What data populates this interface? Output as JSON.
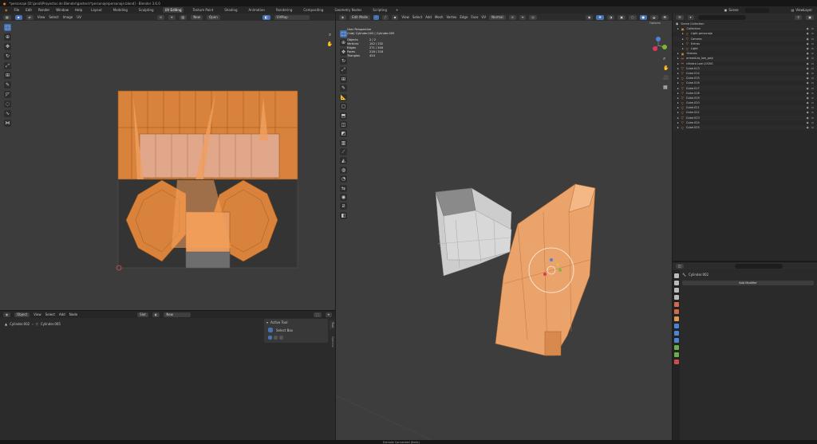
{
  "window": {
    "title": "*personaje [D:\\jandi\\Proyectos de Blender\\gasters\\*personaje\\personaje.blend] - Blender 3.6.0"
  },
  "menubar": {
    "menus": [
      "File",
      "Edit",
      "Render",
      "Window",
      "Help"
    ],
    "workspaces": [
      "Layout",
      "Modeling",
      "Sculpting",
      "UV Editing",
      "Texture Paint",
      "Shading",
      "Animation",
      "Rendering",
      "Compositing",
      "Geometry Nodes",
      "Scripting"
    ],
    "active_workspace": "UV Editing",
    "scene_label": "Scene",
    "viewlayer_label": "ViewLayer"
  },
  "uv_editor": {
    "header_menus": [
      "View",
      "Select",
      "Image",
      "UV"
    ],
    "new_label": "New",
    "open_label": "Open",
    "uvmap_label": "UVMap"
  },
  "lower_left": {
    "mode": "Object",
    "menus": [
      "View",
      "Select",
      "Add",
      "Node"
    ],
    "slot_label": "Slot",
    "new_label": "New",
    "breadcrumb": [
      "Cylinder.002",
      "Cylinder.005"
    ],
    "active_tool_title": "Active Tool",
    "active_tool_item": "Select Box",
    "side_tab_tool": "Tool",
    "side_tab_options": "Options"
  },
  "viewport": {
    "mode": "Edit Mode",
    "menus": [
      "View",
      "Select",
      "Add",
      "Mesh",
      "Vertex",
      "Edge",
      "Face",
      "UV"
    ],
    "orientation": "Normal",
    "options_label": "Options",
    "perspective": "User Perspective",
    "context": "(1ab) Cylinder.002 | Cylinder.005",
    "stats": [
      {
        "k": "Objects",
        "v": "2 / 2"
      },
      {
        "k": "Vertices",
        "v": "142 / 232"
      },
      {
        "k": "Edges",
        "v": "271 / 444"
      },
      {
        "k": "Faces",
        "v": "218 / 218"
      },
      {
        "k": "Triangles",
        "v": "424"
      }
    ]
  },
  "outliner": {
    "search_placeholder": "",
    "root": "Scene Collection",
    "items": [
      {
        "name": "Collection",
        "depth": 0,
        "type": "collection"
      },
      {
        "name": "Light.personaje",
        "depth": 1,
        "type": "mesh"
      },
      {
        "name": "Camera",
        "depth": 1,
        "type": "mesh"
      },
      {
        "name": "Extras",
        "depth": 1,
        "type": "mesh"
      },
      {
        "name": "Light",
        "depth": 1,
        "type": "mesh"
      },
      {
        "name": "Globals",
        "depth": 0,
        "type": "collection"
      },
      {
        "name": "armadura_low_poly",
        "depth": 0,
        "type": "armature"
      },
      {
        "name": "cilindro Low LOCKS",
        "depth": 0,
        "type": "armature"
      },
      {
        "name": "Cube.013",
        "depth": 0,
        "type": "mesh"
      },
      {
        "name": "Cube.014",
        "depth": 0,
        "type": "mesh"
      },
      {
        "name": "Cube.015",
        "depth": 0,
        "type": "mesh"
      },
      {
        "name": "Cube.016",
        "depth": 0,
        "type": "mesh"
      },
      {
        "name": "Cube.017",
        "depth": 0,
        "type": "mesh"
      },
      {
        "name": "Cube.018",
        "depth": 0,
        "type": "mesh"
      },
      {
        "name": "Cube.019",
        "depth": 0,
        "type": "mesh"
      },
      {
        "name": "Cube.020",
        "depth": 0,
        "type": "mesh"
      },
      {
        "name": "Cube.021",
        "depth": 0,
        "type": "mesh"
      },
      {
        "name": "Cube.022",
        "depth": 0,
        "type": "mesh"
      },
      {
        "name": "Cube.023",
        "depth": 0,
        "type": "mesh"
      },
      {
        "name": "Cube.024",
        "depth": 0,
        "type": "mesh"
      },
      {
        "name": "Cube.025",
        "depth": 0,
        "type": "mesh"
      }
    ]
  },
  "properties": {
    "object_name": "Cylinder.002",
    "add_modifier_label": "Add Modifier"
  },
  "statusbar": {
    "message": "Extrude Connected (Italic)"
  },
  "colors": {
    "accent": "#4772b3",
    "uv_orange": "#d9823b",
    "mesh_orange": "#e9a36b",
    "mesh_gray": "#c9c9c9"
  }
}
